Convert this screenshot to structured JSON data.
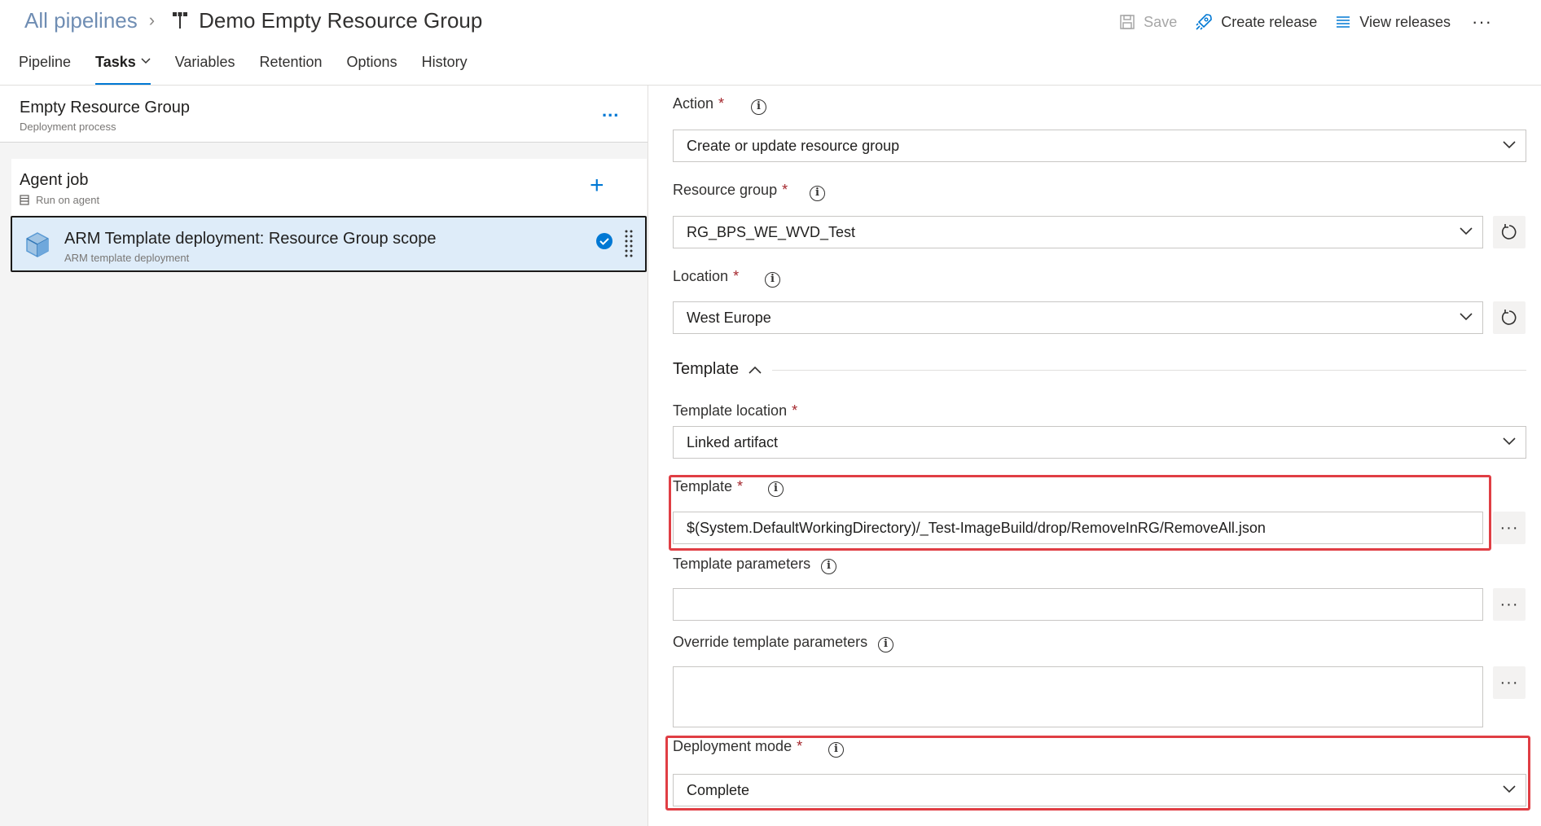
{
  "header": {
    "breadcrumb_root": "All pipelines",
    "breadcrumb_sep": "›",
    "title": "Demo Empty Resource Group",
    "actions": {
      "save": "Save",
      "create_release": "Create release",
      "view_releases": "View releases",
      "more": "···"
    }
  },
  "tabs": [
    {
      "label": "Pipeline",
      "active": false
    },
    {
      "label": "Tasks",
      "active": true
    },
    {
      "label": "Variables",
      "active": false
    },
    {
      "label": "Retention",
      "active": false
    },
    {
      "label": "Options",
      "active": false
    },
    {
      "label": "History",
      "active": false
    }
  ],
  "left": {
    "process": {
      "title": "Empty Resource Group",
      "subtitle": "Deployment process",
      "more": "..."
    },
    "agent_job": {
      "title": "Agent job",
      "subtitle": "Run on agent",
      "add": "+"
    },
    "task": {
      "title": "ARM Template deployment: Resource Group scope",
      "subtitle": "ARM template deployment"
    }
  },
  "form": {
    "action": {
      "label": "Action",
      "required": "*",
      "value": "Create or update resource group"
    },
    "resource_group": {
      "label": "Resource group",
      "required": "*",
      "value": "RG_BPS_WE_WVD_Test"
    },
    "location": {
      "label": "Location",
      "required": "*",
      "value": "West Europe"
    },
    "template_section": {
      "label": "Template"
    },
    "template_location": {
      "label": "Template location",
      "required": "*",
      "value": "Linked artifact"
    },
    "template": {
      "label": "Template",
      "required": "*",
      "value": "$(System.DefaultWorkingDirectory)/_Test-ImageBuild/drop/RemoveInRG/RemoveAll.json"
    },
    "template_parameters": {
      "label": "Template parameters",
      "value": ""
    },
    "override_parameters": {
      "label": "Override template parameters",
      "value": ""
    },
    "deployment_mode": {
      "label": "Deployment mode",
      "required": "*",
      "value": "Complete"
    },
    "ellipsis": "···",
    "info_glyph": "i"
  },
  "colors": {
    "accent": "#0078d4",
    "highlight": "#e03e44",
    "selected_task_bg": "#deecf9",
    "required": "#a4262c"
  }
}
